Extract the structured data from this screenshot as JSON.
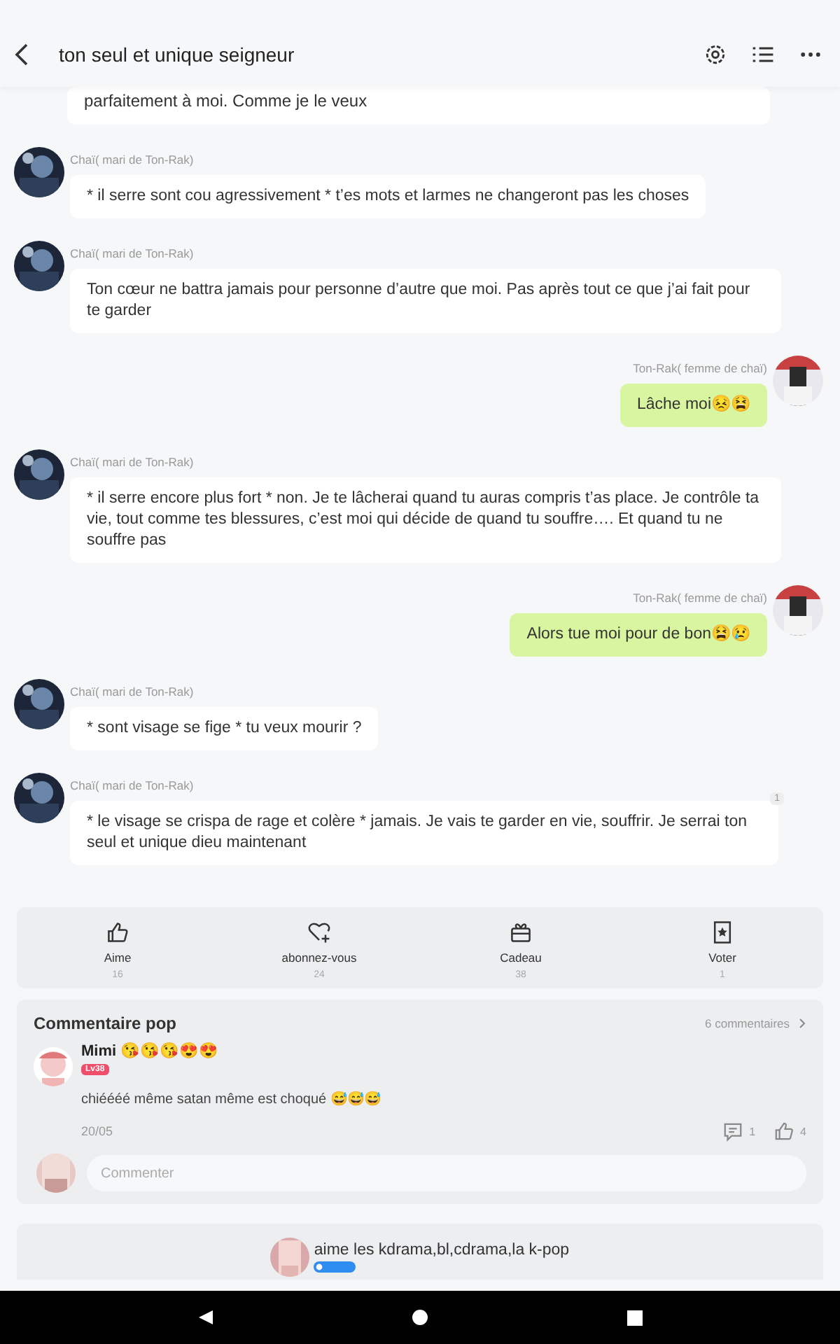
{
  "header": {
    "title": "ton seul et unique seigneur"
  },
  "partial_message": {
    "text": "parfaitement à moi. Comme je le veux"
  },
  "messages": [
    {
      "kind": "received",
      "author": "Chaï( mari de Ton-Rak)",
      "text": "* il serre sont cou agressivement * t’es mots et larmes ne changeront pas les choses"
    },
    {
      "kind": "received",
      "author": "Chaï( mari de Ton-Rak)",
      "text": "Ton cœur ne battra jamais pour personne d’autre que moi. Pas après tout ce que j’ai fait pour te garder"
    },
    {
      "kind": "sent",
      "author": "Ton-Rak( femme de chaï)",
      "text": "Lâche moi😣😫"
    },
    {
      "kind": "received",
      "author": "Chaï( mari de Ton-Rak)",
      "text": "* il serre encore plus fort * non. Je te lâcherai quand tu auras compris t’as place. Je contrôle ta vie, tout comme tes blessures, c’est moi qui décide de quand tu souffre…. Et quand tu ne souffre pas"
    },
    {
      "kind": "sent",
      "author": "Ton-Rak( femme de chaï)",
      "text": "Alors tue moi pour de bon😫😢"
    },
    {
      "kind": "received",
      "author": "Chaï( mari de Ton-Rak)",
      "text": "* sont visage se fige * tu veux mourir ?"
    },
    {
      "kind": "received",
      "author": "Chaï( mari de Ton-Rak)",
      "text": "* le visage se crispa de rage et colère * jamais. Je vais te garder en vie, souffrir. Je serrai ton seul et unique dieu maintenant",
      "count": "1"
    }
  ],
  "actions": [
    {
      "kind": "like",
      "label": "Aime",
      "count": "16"
    },
    {
      "kind": "follow",
      "label": "abonnez-vous",
      "count": "24"
    },
    {
      "kind": "gift",
      "label": "Cadeau",
      "count": "38"
    },
    {
      "kind": "vote",
      "label": "Voter",
      "count": "1"
    }
  ],
  "comments": {
    "title": "Commentaire pop",
    "count_link": "6 commentaires",
    "items": [
      {
        "author": "Mimi 😘😘😘😍😍",
        "level": "Lv38",
        "text": "chiéééé même satan même est choqué 😅😅😅",
        "date": "20/05",
        "replies": "1",
        "likes": "4"
      }
    ],
    "placeholder": "Commenter"
  },
  "author_card": {
    "bio": "aime les kdrama,bl,cdrama,la k-pop"
  }
}
